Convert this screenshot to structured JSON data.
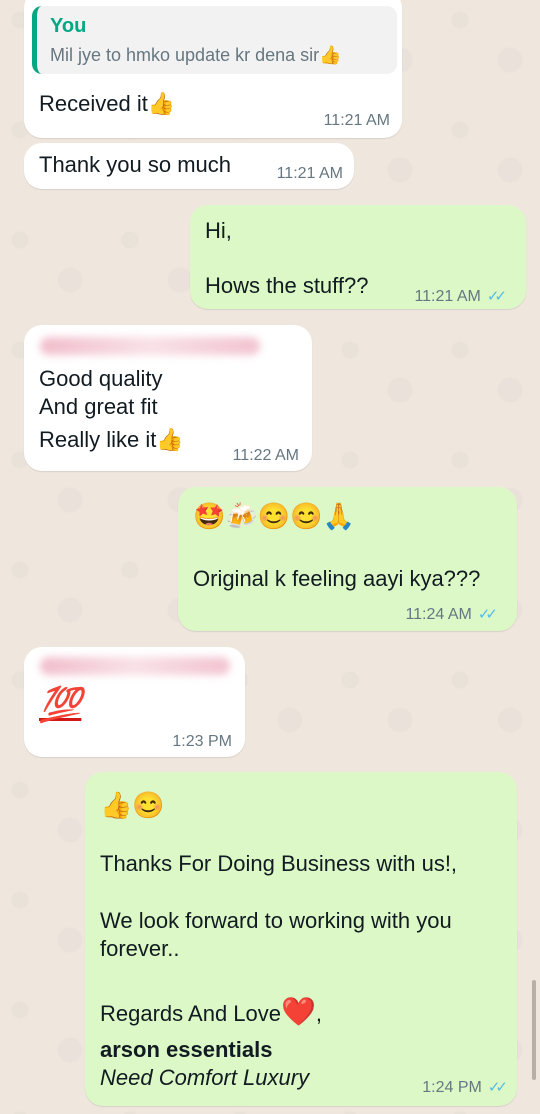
{
  "messages": {
    "m1": {
      "quote_author": "You",
      "quote_text": "Mil jye to hmko update kr dena sir👍",
      "text": "Received it👍",
      "time": "11:21 AM"
    },
    "m2": {
      "text": "Thank you so much",
      "time": "11:21 AM"
    },
    "m3": {
      "line1": "Hi,",
      "line2": "Hows the stuff??",
      "time": "11:21 AM",
      "ticks": "✓✓"
    },
    "m4": {
      "line1": "Good quality",
      "line2": "And great fit",
      "line3": "Really like it👍",
      "time": "11:22 AM"
    },
    "m5": {
      "emojis": "🤩🍻😊😊🙏",
      "text": "Original k feeling aayi kya???",
      "time": "11:24 AM",
      "ticks": "✓✓"
    },
    "m6": {
      "text": "💯",
      "time": "1:23 PM"
    },
    "m7": {
      "emojis": "👍😊",
      "line1": "Thanks For Doing Business with us!,",
      "line2": "We look forward to working with you",
      "line3": "forever..",
      "line4": "Regards And Love",
      "heart": "❤️",
      "comma": ",",
      "brand": "arson essentials",
      "tagline": "Need Comfort Luxury",
      "time": "1:24 PM",
      "ticks": "✓✓"
    }
  },
  "colors": {
    "background": "#efe7de",
    "incoming_bubble": "#ffffff",
    "outgoing_bubble": "#dcf8c6",
    "quote_accent": "#06a884",
    "read_ticks": "#53bdeb"
  }
}
